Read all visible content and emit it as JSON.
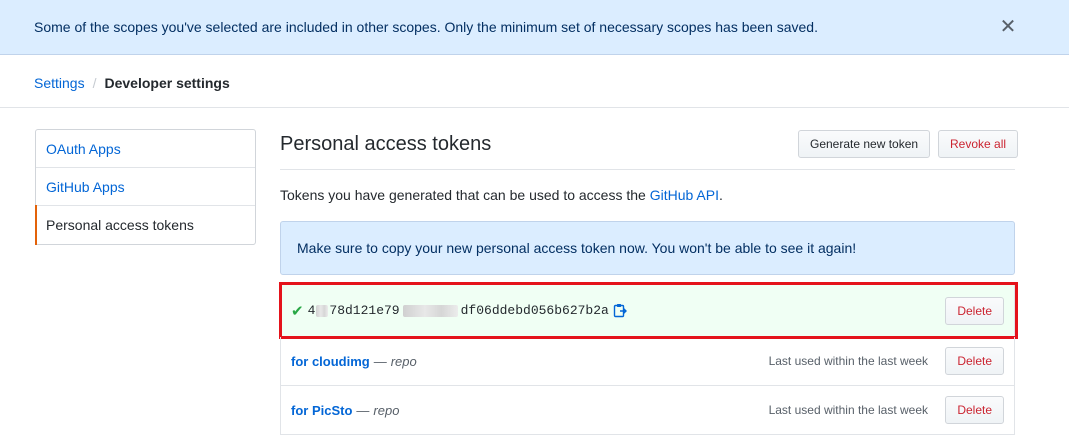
{
  "flash": {
    "message": "Some of the scopes you've selected are included in other scopes. Only the minimum set of necessary scopes has been saved.",
    "close_glyph": "✕"
  },
  "breadcrumb": {
    "root": "Settings",
    "separator": "/",
    "current": "Developer settings"
  },
  "sidebar": {
    "items": [
      {
        "label": "OAuth Apps"
      },
      {
        "label": "GitHub Apps"
      },
      {
        "label": "Personal access tokens"
      }
    ]
  },
  "main": {
    "title": "Personal access tokens",
    "generate_button": "Generate new token",
    "revoke_button": "Revoke all",
    "intro_prefix": "Tokens you have generated that can be used to access the ",
    "intro_link": "GitHub API",
    "intro_suffix": ".",
    "notice": "Make sure to copy your new personal access token now. You won't be able to see it again!"
  },
  "new_token": {
    "check_glyph": "✔",
    "value_start": "4",
    "value_part2": "78d121e79",
    "value_end": "df06ddebd056b627b2a",
    "delete_label": "Delete"
  },
  "tokens": [
    {
      "name": "for cloudimg",
      "separator": "—",
      "scope": "repo",
      "last_used": "Last used within the last week",
      "delete_label": "Delete"
    },
    {
      "name": "for PicSto",
      "separator": "—",
      "scope": "repo",
      "last_used": "Last used within the last week",
      "delete_label": "Delete"
    }
  ],
  "colors": {
    "link": "#0366d6",
    "danger": "#cb2431",
    "success": "#28a745",
    "flash_bg": "#dbedff",
    "highlight_border": "#e4131b",
    "selected_marker": "#e36209"
  }
}
